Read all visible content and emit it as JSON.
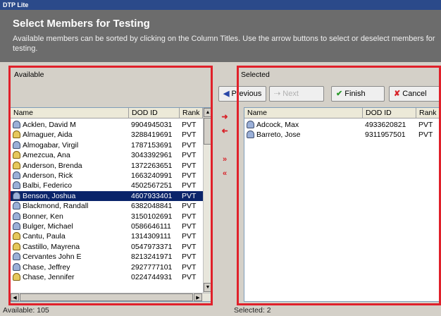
{
  "window_title": "DTP Lite",
  "header": {
    "title": "Select Members for Testing",
    "description": "Available members can be sorted by clicking on the Column Titles. Use the arrow buttons to select or deselect members for testing."
  },
  "available": {
    "label": "Available",
    "columns": [
      "Name",
      "DOD ID",
      "Rank"
    ],
    "rows": [
      {
        "name": "Acklen, David M",
        "dod": "9904945031",
        "rank": "PVT",
        "icon": "person-icon"
      },
      {
        "name": "Almaguer, Aida",
        "dod": "3288419691",
        "rank": "PVT",
        "icon": "person-alt-icon"
      },
      {
        "name": "Almogabar, Virgil",
        "dod": "1787153691",
        "rank": "PVT",
        "icon": "person-icon"
      },
      {
        "name": "Amezcua, Ana",
        "dod": "3043392961",
        "rank": "PVT",
        "icon": "person-alt-icon"
      },
      {
        "name": "Anderson, Brenda",
        "dod": "1372263651",
        "rank": "PVT",
        "icon": "person-alt-icon"
      },
      {
        "name": "Anderson, Rick",
        "dod": "1663240991",
        "rank": "PVT",
        "icon": "person-icon"
      },
      {
        "name": "Balbi, Federico",
        "dod": "4502567251",
        "rank": "PVT",
        "icon": "person-icon"
      },
      {
        "name": "Benson, Joshua",
        "dod": "4607933401",
        "rank": "PVT",
        "icon": "person-icon",
        "selected": true
      },
      {
        "name": "Blackmond, Randall",
        "dod": "6382048841",
        "rank": "PVT",
        "icon": "person-icon"
      },
      {
        "name": "Bonner, Ken",
        "dod": "3150102691",
        "rank": "PVT",
        "icon": "person-icon"
      },
      {
        "name": "Bulger, Michael",
        "dod": "0586646111",
        "rank": "PVT",
        "icon": "person-icon"
      },
      {
        "name": "Cantu, Paula",
        "dod": "1314309111",
        "rank": "PVT",
        "icon": "person-alt-icon"
      },
      {
        "name": "Castillo, Mayrena",
        "dod": "0547973371",
        "rank": "PVT",
        "icon": "person-alt-icon"
      },
      {
        "name": "Cervantes John E",
        "dod": "8213241971",
        "rank": "PVT",
        "icon": "person-icon"
      },
      {
        "name": "Chase, Jeffrey",
        "dod": "2927777101",
        "rank": "PVT",
        "icon": "person-icon"
      },
      {
        "name": "Chase, Jennifer",
        "dod": "0224744931",
        "rank": "PVT",
        "icon": "person-alt-icon"
      }
    ]
  },
  "selected": {
    "label": "Selected",
    "columns": [
      "Name",
      "DOD ID",
      "Rank"
    ],
    "rows": [
      {
        "name": "Adcock, Max",
        "dod": "4933620821",
        "rank": "PVT",
        "icon": "person-icon"
      },
      {
        "name": "Barreto, Jose",
        "dod": "9311957501",
        "rank": "PVT",
        "icon": "person-icon"
      }
    ]
  },
  "nav": {
    "previous": "Previous",
    "next": "Next",
    "finish": "Finish",
    "cancel": "Cancel"
  },
  "status": {
    "available": "Available: 105",
    "selected": "Selected: 2"
  },
  "colors": {
    "header_bg": "#6c6c6c",
    "highlight_border": "#e0202a",
    "selection_bg": "#0a246a",
    "arrow_color": "#d8232a"
  }
}
